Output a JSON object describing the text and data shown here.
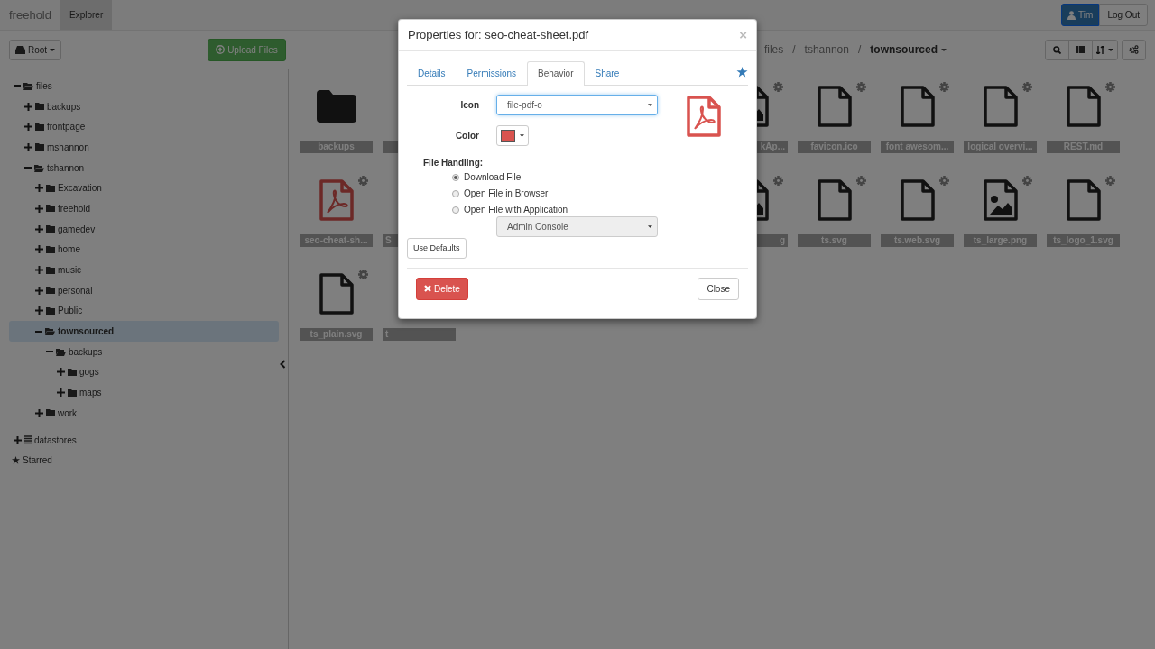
{
  "navbar": {
    "brand": "freehold",
    "tabs": [
      {
        "label": "Explorer",
        "selected": true
      }
    ],
    "user_button": "Tim",
    "logout_button": "Log Out"
  },
  "toolbar": {
    "root_button": "Root",
    "upload_button": "Upload Files",
    "breadcrumb": {
      "separator": "/",
      "items": [
        {
          "label": "files",
          "current": false
        },
        {
          "label": "tshannon",
          "current": false
        },
        {
          "label": "townsourced",
          "current": true
        }
      ]
    }
  },
  "tree": [
    {
      "label": "files",
      "kind": "folder",
      "expanded": true,
      "selected": false,
      "children": [
        {
          "label": "backups",
          "kind": "folder",
          "expanded": false,
          "selected": false
        },
        {
          "label": "frontpage",
          "kind": "folder",
          "expanded": false,
          "selected": false
        },
        {
          "label": "mshannon",
          "kind": "folder",
          "expanded": false,
          "selected": false
        },
        {
          "label": "tshannon",
          "kind": "folder",
          "expanded": true,
          "selected": false,
          "children": [
            {
              "label": "Excavation",
              "kind": "folder",
              "expanded": false,
              "selected": false
            },
            {
              "label": "freehold",
              "kind": "folder",
              "expanded": false,
              "selected": false
            },
            {
              "label": "gamedev",
              "kind": "folder",
              "expanded": false,
              "selected": false
            },
            {
              "label": "home",
              "kind": "folder",
              "expanded": false,
              "selected": false
            },
            {
              "label": "music",
              "kind": "folder",
              "expanded": false,
              "selected": false
            },
            {
              "label": "personal",
              "kind": "folder",
              "expanded": false,
              "selected": false
            },
            {
              "label": "Public",
              "kind": "folder",
              "expanded": false,
              "selected": false
            },
            {
              "label": "townsourced",
              "kind": "folder",
              "expanded": true,
              "selected": true,
              "children": [
                {
                  "label": "backups",
                  "kind": "folder",
                  "expanded": true,
                  "selected": false,
                  "children": [
                    {
                      "label": "gogs",
                      "kind": "folder",
                      "expanded": false,
                      "selected": false
                    },
                    {
                      "label": "maps",
                      "kind": "folder",
                      "expanded": false,
                      "selected": false
                    }
                  ]
                }
              ]
            },
            {
              "label": "work",
              "kind": "folder",
              "expanded": false,
              "selected": false
            }
          ]
        }
      ]
    },
    {
      "label": "datastores",
      "kind": "datastore",
      "expanded": false,
      "selected": false
    },
    {
      "label": "Starred",
      "kind": "starred",
      "selected": false
    }
  ],
  "files": {
    "rows": [
      {
        "left": [
          {
            "label": "backups",
            "kind": "folder"
          },
          {
            "kind": "covered"
          }
        ],
        "right": [
          {
            "label": "kAp...",
            "kind": "image"
          },
          {
            "label": "favicon.ico",
            "kind": "file"
          },
          {
            "label": "font awesom...",
            "kind": "file"
          },
          {
            "label": "logical overvi...",
            "kind": "file"
          },
          {
            "label": "REST.md",
            "kind": "file"
          }
        ]
      },
      {
        "left": [
          {
            "label": "seo-cheat-sh...",
            "kind": "pdf"
          },
          {
            "label": "S",
            "kind": "covered"
          }
        ],
        "right": [
          {
            "label": "g",
            "kind": "image"
          },
          {
            "label": "ts.svg",
            "kind": "file"
          },
          {
            "label": "ts.web.svg",
            "kind": "file"
          },
          {
            "label": "ts_large.png",
            "kind": "image"
          },
          {
            "label": "ts_logo_1.svg",
            "kind": "file"
          }
        ]
      },
      {
        "left": [
          {
            "label": "ts_plain.svg",
            "kind": "file"
          },
          {
            "label": "t",
            "kind": "covered"
          }
        ],
        "right": []
      }
    ]
  },
  "dialog": {
    "title": "Properties for: seo-cheat-sheet.pdf",
    "close_glyph": "×",
    "tabs": [
      {
        "label": "Details",
        "selected": false
      },
      {
        "label": "Permissions",
        "selected": false
      },
      {
        "label": "Behavior",
        "selected": true
      },
      {
        "label": "Share",
        "selected": false
      }
    ],
    "starred": true,
    "icon_label": "Icon",
    "icon_value": "file-pdf-o",
    "color_label": "Color",
    "color": "#d9534f",
    "file_handling_label": "File Handling:",
    "options": [
      {
        "label": "Download File",
        "selected": true
      },
      {
        "label": "Open File in Browser",
        "selected": false
      },
      {
        "label": "Open File with Application",
        "selected": false
      }
    ],
    "application": {
      "value": "Admin Console",
      "disabled": true
    },
    "use_defaults_button": "Use Defaults",
    "delete_button": "Delete",
    "close_button": "Close"
  }
}
